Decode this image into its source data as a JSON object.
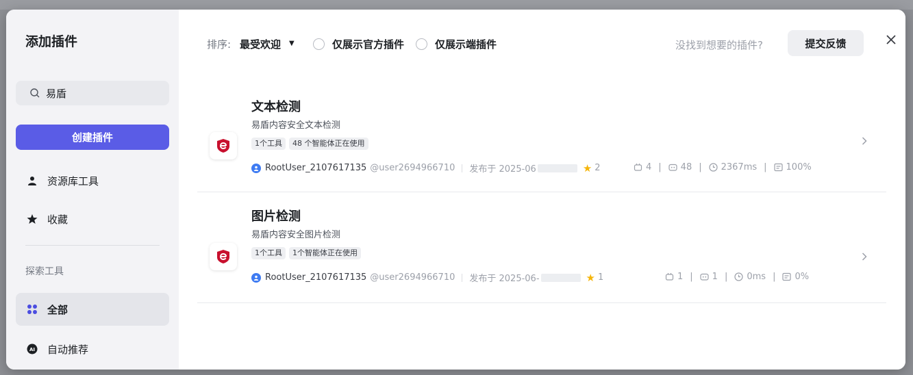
{
  "sidebar": {
    "title": "添加插件",
    "search_value": "易盾",
    "create_button": "创建插件",
    "nav": [
      {
        "label": "资源库工具",
        "icon": "person-icon"
      },
      {
        "label": "收藏",
        "icon": "star-icon"
      }
    ],
    "section_label": "探索工具",
    "explore": [
      {
        "label": "全部",
        "icon": "grid-icon",
        "active": true
      },
      {
        "label": "自动推荐",
        "icon": "ai-icon",
        "active": false
      }
    ]
  },
  "toolbar": {
    "sort_label": "排序:",
    "sort_value": "最受欢迎",
    "filter_official": "仅展示官方插件",
    "filter_client": "仅展示端插件",
    "help_text": "没找到想要的插件?",
    "feedback_button": "提交反馈"
  },
  "plugins": [
    {
      "title": "文本检测",
      "description": "易盾内容安全文本检测",
      "tags": [
        "1个工具",
        "48 个智能体正在使用"
      ],
      "author": "RootUser_2107617135",
      "handle": "@user2694966710",
      "published": "发布于 2025-06",
      "stars": "2",
      "stats": {
        "calls": "4",
        "bots": "48",
        "latency": "2367ms",
        "success": "100%"
      }
    },
    {
      "title": "图片检测",
      "description": "易盾内容安全图片检测",
      "tags": [
        "1个工具",
        "1个智能体正在使用"
      ],
      "author": "RootUser_2107617135",
      "handle": "@user2694966710",
      "published": "发布于 2025-06-",
      "stars": "1",
      "stats": {
        "calls": "1",
        "bots": "1",
        "latency": "0ms",
        "success": "0%"
      }
    }
  ],
  "colors": {
    "accent": "#5a5ce6",
    "star": "#f5b50a",
    "brand_red": "#c8102e"
  }
}
